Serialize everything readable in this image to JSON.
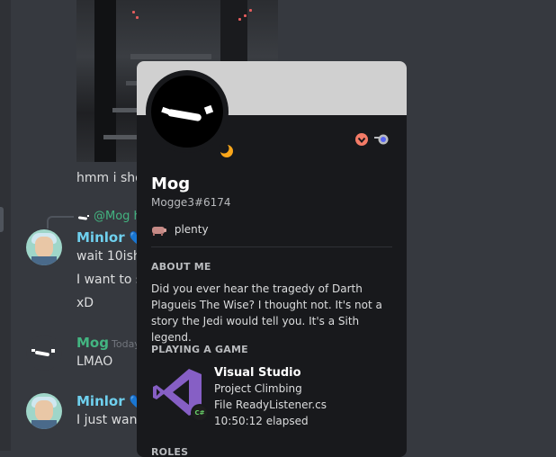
{
  "chat": {
    "partial_message_1": "hmm i sho",
    "reply_preview": "@Mog h",
    "minlor_name": "Minlor",
    "minlor_badge": "💙",
    "msg_wait": "wait 10ish",
    "msg_want": "I want to s",
    "msg_xd": "xD",
    "mog_name": "Mog",
    "mog_timestamp": "Today",
    "msg_lmao": "LMAO",
    "msg_just": "I just wann"
  },
  "profile": {
    "username": "Mog",
    "tag": "Mogge3#6174",
    "custom_status": "plenty",
    "about_heading": "ABOUT ME",
    "about_text": "Did you ever hear the tragedy of Darth Plagueis The Wise? I thought not. It's not a story the Jedi would tell you. It's a Sith legend.",
    "game_heading": "PLAYING A GAME",
    "game_name": "Visual Studio",
    "game_details": "Project Climbing",
    "game_state": "File ReadyListener.cs",
    "game_elapsed": "10:50:12 elapsed",
    "roles_heading": "ROLES",
    "game_small_icon_text": "C#"
  },
  "colors": {
    "background": "#36393f",
    "popout_bg": "#18191c",
    "banner": "#d0d0d0",
    "minlor_name_color": "#6fd0ee",
    "mog_name_color": "#43b581",
    "vs_purple": "#865fc5"
  },
  "icons": {
    "moon": "idle-moon-icon",
    "badge_1": "hypesquad-heart-icon",
    "badge_2": "nitro-boost-icon",
    "status_emoji": "pig-emoji-icon"
  }
}
